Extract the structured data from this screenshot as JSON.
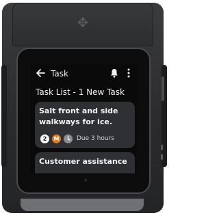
{
  "app_bar": {
    "title": "Task",
    "back_icon": "arrow-left-icon",
    "notification_icon": "bell-icon",
    "menu_icon": "more-vert-icon"
  },
  "task_list": {
    "heading": "Task List - 1 New Task",
    "items": [
      {
        "title": "Salt front and side walkways for ice.",
        "count_badge": "2",
        "assignee_initial": "M",
        "clock_icon": "clock-icon",
        "due": "Due 3 hours"
      },
      {
        "title": "Customer assistance"
      }
    ]
  },
  "colors": {
    "assignee_badge": "#e07b1e",
    "card_background": "#2f3033",
    "screen_background": "#0a0a0b"
  }
}
